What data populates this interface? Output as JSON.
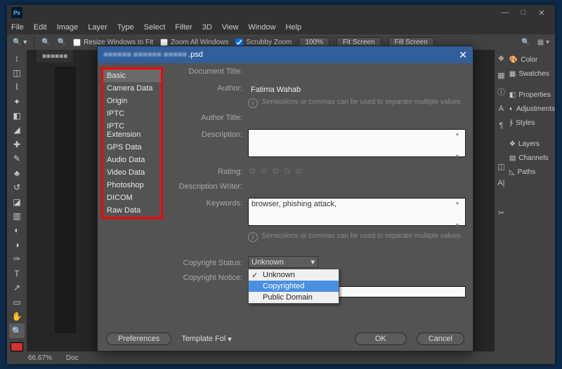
{
  "app": {
    "ps_logo": "Ps"
  },
  "win_buttons": {
    "min": "—",
    "max": "□",
    "close": "✕"
  },
  "menubar": [
    "File",
    "Edit",
    "Image",
    "Layer",
    "Type",
    "Select",
    "Filter",
    "3D",
    "View",
    "Window",
    "Help"
  ],
  "optbar": {
    "resize_windows": "Resize Windows to Fit",
    "zoom_all": "Zoom All Windows",
    "scrubby": "Scrubby Zoom",
    "hundred": "100%",
    "fit": "Fit Screen",
    "fill": "Fill Screen"
  },
  "rightpanel": {
    "items": [
      "Color",
      "Swatches",
      "Properties",
      "Adjustments",
      "Styles",
      "Layers",
      "Channels",
      "Paths"
    ]
  },
  "status": {
    "zoom": "66.67%",
    "doc": "Doc"
  },
  "dialog": {
    "filename_blur": "■■■■■■ ■■■■■■ ■■■■■",
    "filename_ext": ".psd",
    "categories": [
      "Basic",
      "Camera Data",
      "Origin",
      "IPTC",
      "IPTC Extension",
      "GPS Data",
      "Audio Data",
      "Video Data",
      "Photoshop",
      "DICOM",
      "Raw Data"
    ],
    "labels": {
      "doc_title": "Document Title:",
      "author": "Author:",
      "author_title": "Author Title:",
      "description": "Description:",
      "rating": "Rating:",
      "desc_writer": "Description Writer:",
      "keywords": "Keywords:",
      "copyright_status": "Copyright Status:",
      "copyright_notice": "Copyright Notice:"
    },
    "values": {
      "author": "Fatima Wahab",
      "keywords": "browser, phishing attack,",
      "copyright_status": "Unknown"
    },
    "hint_text": "Semicolons or commas can be used to separate multiple values",
    "copyright_options": [
      "Unknown",
      "Copyrighted",
      "Public Domain"
    ],
    "footer": {
      "preferences": "Preferences",
      "template": "Template Fol",
      "ok": "OK",
      "cancel": "Cancel"
    }
  }
}
